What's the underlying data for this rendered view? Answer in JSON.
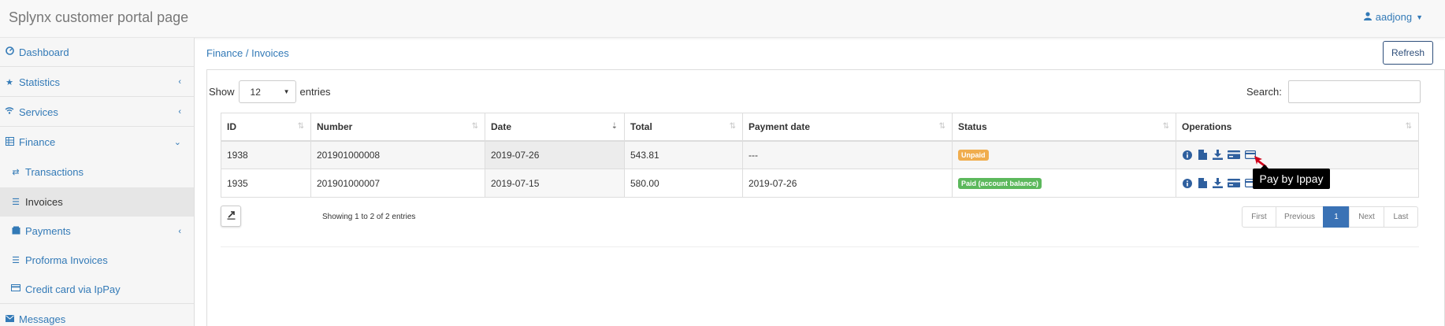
{
  "app": {
    "title": "Splynx customer portal page",
    "user": "aadjong"
  },
  "sidebar": {
    "items": [
      {
        "label": "Dashboard",
        "icon": "dashboard-icon"
      },
      {
        "label": "Statistics",
        "icon": "star-icon"
      },
      {
        "label": "Services",
        "icon": "wifi-icon"
      },
      {
        "label": "Finance",
        "icon": "finance-icon"
      },
      {
        "label": "Transactions",
        "icon": "transfer-icon"
      },
      {
        "label": "Invoices",
        "icon": "list-icon"
      },
      {
        "label": "Payments",
        "icon": "payments-icon"
      },
      {
        "label": "Proforma Invoices",
        "icon": "list-icon"
      },
      {
        "label": "Credit card via IpPay",
        "icon": "credit-card-icon"
      },
      {
        "label": "Messages",
        "icon": "envelope-icon"
      }
    ]
  },
  "header": {
    "breadcrumb": "Finance / Invoices",
    "refresh_label": "Refresh"
  },
  "table_controls": {
    "show_label": "Show",
    "entries_label": "entries",
    "entries_value": "12",
    "search_label": "Search:",
    "search_value": ""
  },
  "table": {
    "columns": [
      "ID",
      "Number",
      "Date",
      "Total",
      "Payment date",
      "Status",
      "Operations"
    ],
    "rows": [
      {
        "id": "1938",
        "number": "201901000008",
        "date": "2019-07-26",
        "total": "543.81",
        "payment_date": "---",
        "status": "Unpaid",
        "status_color": "#f0ad4e"
      },
      {
        "id": "1935",
        "number": "201901000007",
        "date": "2019-07-15",
        "total": "580.00",
        "payment_date": "2019-07-26",
        "status": "Paid (account balance)",
        "status_color": "#5cb85c"
      }
    ]
  },
  "footer": {
    "info": "Showing 1 to 2 of 2 entries"
  },
  "pagination": {
    "first": "First",
    "previous": "Previous",
    "current": "1",
    "next": "Next",
    "last": "Last"
  },
  "tooltip": {
    "text": "Pay by Ippay"
  },
  "colors": {
    "accent": "#337ab7",
    "pager_active": "#3a72b5"
  }
}
